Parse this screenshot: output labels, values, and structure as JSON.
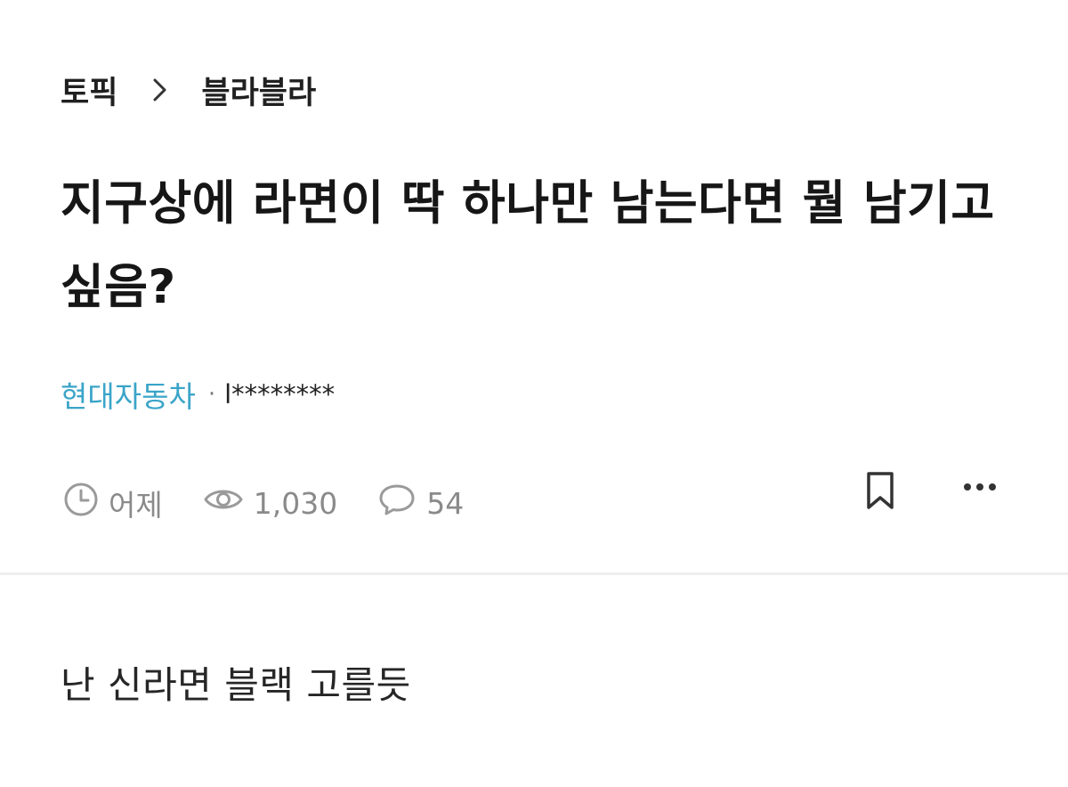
{
  "breadcrumb": {
    "topic_label": "토픽",
    "separator_icon": "chevron-right-icon",
    "channel_label": "블라블라"
  },
  "post": {
    "title": "지구상에 라면이 딱 하나만 남는다면 뭘 남기고 싶음?",
    "company": "현대자동차",
    "separator": "·",
    "nickname": "l********",
    "time": "어제",
    "views": "1,030",
    "comments": "54",
    "body": "난 신라면 블랙 고를듯"
  },
  "icons": {
    "time": "clock-icon",
    "views": "eye-icon",
    "comments": "comment-bubble-icon",
    "bookmark": "bookmark-icon",
    "more": "more-dots-icon"
  },
  "colors": {
    "company": "#3aa4c8",
    "meta": "#8a8a8a",
    "title": "#161616",
    "divider": "#eeeeee"
  }
}
